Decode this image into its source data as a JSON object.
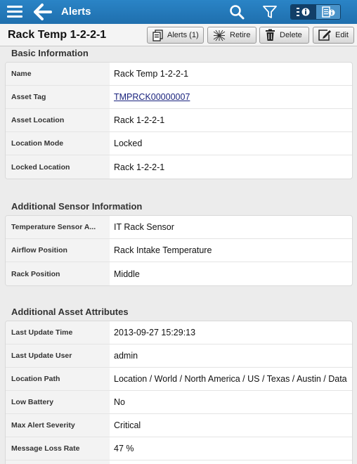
{
  "nav": {
    "title": "Alerts",
    "icons": {
      "menu": "hamburger-icon",
      "back": "back-arrow-icon",
      "search": "search-icon",
      "filter": "filter-icon",
      "view_list": "list-detail-icon",
      "view_detail": "detail-icon"
    }
  },
  "header": {
    "asset_title": "Rack Temp 1-2-2-1",
    "buttons": {
      "alerts": "Alerts (1)",
      "retire": "Retire",
      "delete": "Delete",
      "edit": "Edit"
    }
  },
  "sections": {
    "basic": {
      "title": "Basic Information",
      "rows": [
        {
          "label": "Name",
          "value": "Rack Temp 1-2-2-1"
        },
        {
          "label": "Asset Tag",
          "value": "TMPRCK00000007"
        },
        {
          "label": "Asset Location",
          "value": "Rack 1-2-2-1"
        },
        {
          "label": "Location Mode",
          "value": "Locked"
        },
        {
          "label": "Locked Location",
          "value": "Rack 1-2-2-1"
        }
      ]
    },
    "sensor": {
      "title": "Additional Sensor Information",
      "rows": [
        {
          "label": "Temperature Sensor A...",
          "value": "IT Rack Sensor"
        },
        {
          "label": "Airflow Position",
          "value": "Rack Intake Temperature"
        },
        {
          "label": "Rack Position",
          "value": "Middle"
        }
      ]
    },
    "attributes": {
      "title": "Additional Asset Attributes",
      "rows": [
        {
          "label": "Last Update Time",
          "value": "2013-09-27 15:29:13"
        },
        {
          "label": "Last Update User",
          "value": "admin"
        },
        {
          "label": "Location Path",
          "value": "Location / World / North America / US / Texas / Austin / Data"
        },
        {
          "label": "Low Battery",
          "value": "No"
        },
        {
          "label": "Max Alert Severity",
          "value": "Critical"
        },
        {
          "label": "Message Loss Rate",
          "value": "47 %"
        }
      ]
    }
  },
  "colors": {
    "topbar": "#1f6fae",
    "link": "#1a237e"
  }
}
